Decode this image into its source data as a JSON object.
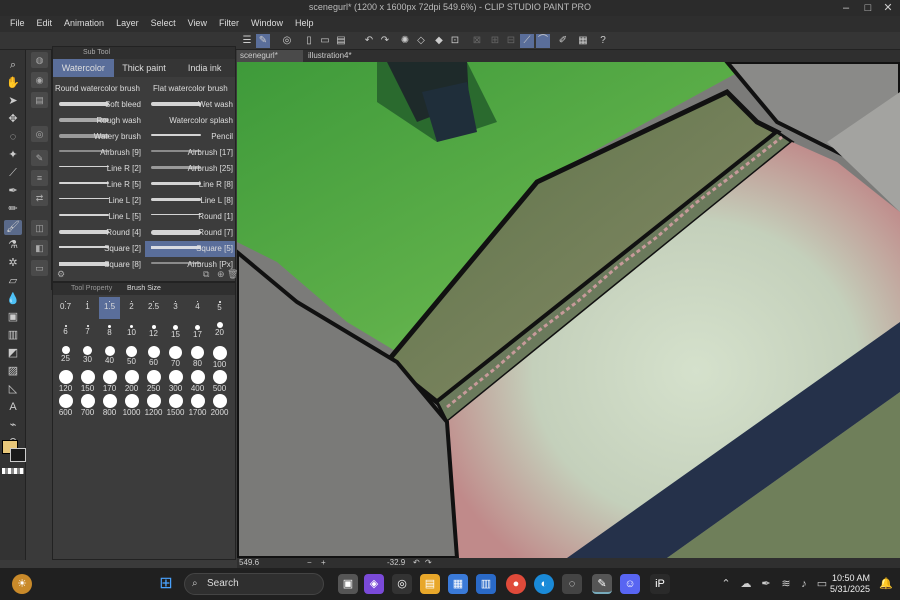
{
  "window": {
    "title": "scenegurl* (1200 x 1600px 72dpi 549.6%) - CLIP STUDIO PAINT PRO"
  },
  "menu": [
    "File",
    "Edit",
    "Animation",
    "Layer",
    "Select",
    "View",
    "Filter",
    "Window",
    "Help"
  ],
  "subtool": {
    "header": "Sub Tool",
    "tabs": [
      "Watercolor",
      "Thick paint",
      "India ink"
    ],
    "selected_tab": "Watercolor",
    "brushes": [
      [
        "Round watercolor brush",
        "Flat watercolor brush"
      ],
      [
        "Soft bleed",
        "Wet wash"
      ],
      [
        "Rough wash",
        "Watercolor splash"
      ],
      [
        "Watery brush",
        "Pencil"
      ],
      [
        "Airbrush [9]",
        "Airbrush [17]"
      ],
      [
        "Line R [2]",
        "Airbrush [25]"
      ],
      [
        "Line R [5]",
        "Line R [8]"
      ],
      [
        "Line L [2]",
        "Line L [8]"
      ],
      [
        "Line L [5]",
        "Round [1]"
      ],
      [
        "Round [4]",
        "Round [7]"
      ],
      [
        "Square [2]",
        "Square [5]"
      ],
      [
        "Square [8]",
        "Airbrush [Px]"
      ]
    ],
    "selected_brush": "Square [5]"
  },
  "brush_size": {
    "tabs": [
      "Tool Property",
      "Brush Size"
    ],
    "sizes": [
      "0.7",
      "1",
      "1.5",
      "2",
      "2.5",
      "3",
      "4",
      "5",
      "6",
      "7",
      "8",
      "10",
      "12",
      "15",
      "17",
      "20",
      "25",
      "30",
      "40",
      "50",
      "60",
      "70",
      "80",
      "100",
      "120",
      "150",
      "170",
      "200",
      "250",
      "300",
      "400",
      "500",
      "600",
      "700",
      "800",
      "1000",
      "1200",
      "1500",
      "1700",
      "2000"
    ],
    "selected": "1.5"
  },
  "document_tabs": [
    "scenegurl*",
    "illustration4*"
  ],
  "status": {
    "zoom": "549.6",
    "rotation": "-32.9"
  },
  "taskbar": {
    "search_placeholder": "Search",
    "time": "10:50 AM",
    "date": "5/31/2025"
  },
  "colors": {
    "main": "#e8c77a",
    "sub": "#1a1a1a",
    "accent": "#5a6e9a"
  }
}
